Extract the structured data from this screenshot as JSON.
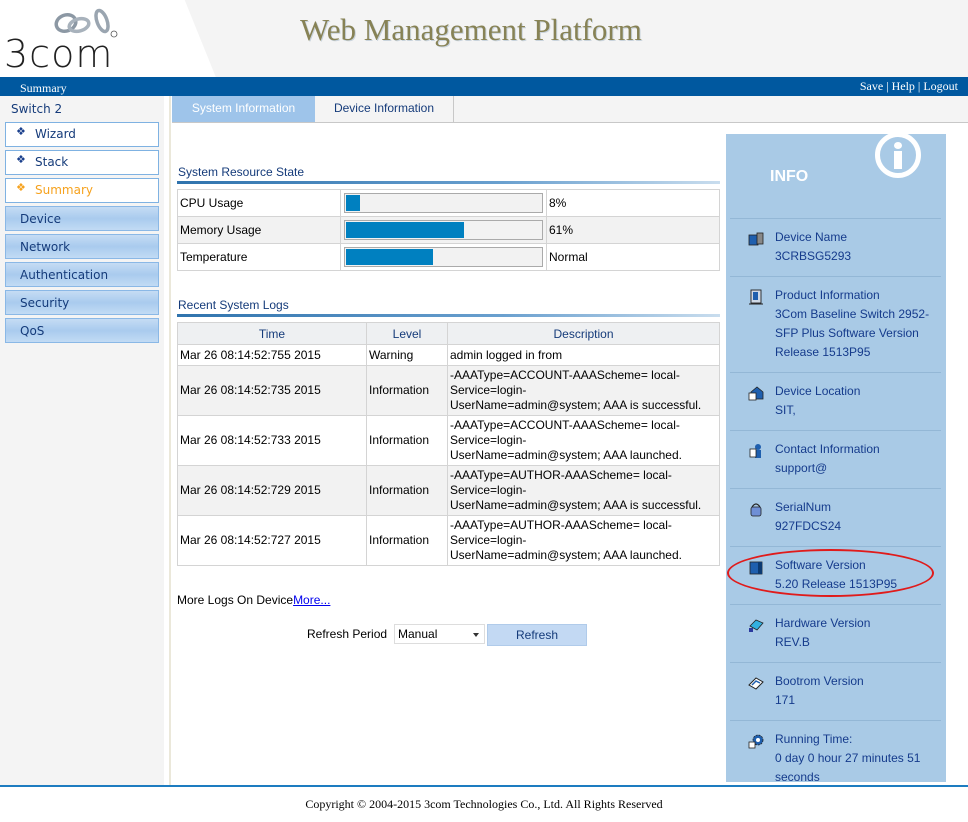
{
  "header": {
    "logo_text": "3com",
    "title": "Web Management Platform"
  },
  "topbar": {
    "breadcrumb": "Summary",
    "links": [
      "Save",
      "Help",
      "Logout"
    ],
    "separator": " | "
  },
  "sidebar": {
    "device_label": "Switch 2",
    "sub_items": [
      {
        "label": "Wizard",
        "active": false
      },
      {
        "label": "Stack",
        "active": false
      },
      {
        "label": "Summary",
        "active": true
      }
    ],
    "groups": [
      "Device",
      "Network",
      "Authentication",
      "Security",
      "QoS"
    ]
  },
  "tabs": [
    {
      "label": "System Information",
      "active": true
    },
    {
      "label": "Device Information",
      "active": false
    }
  ],
  "resources": {
    "title": "System Resource State",
    "rows": [
      {
        "label": "CPU Usage",
        "fill_percent": 8,
        "value": "8%"
      },
      {
        "label": "Memory Usage",
        "fill_percent": 61,
        "value": "61%"
      },
      {
        "label": "Temperature",
        "fill_percent": 45,
        "value": "Normal"
      }
    ]
  },
  "logs": {
    "title": "Recent System Logs",
    "columns": [
      "Time",
      "Level",
      "Description"
    ],
    "rows": [
      {
        "time": "Mar 26 08:14:52:755 2015",
        "level": "Warning",
        "desc": "admin logged in from"
      },
      {
        "time": "Mar 26 08:14:52:735 2015",
        "level": "Information",
        "desc": "-AAAType=ACCOUNT-AAAScheme= local-\nService=login-\nUserName=admin@system; AAA is successful."
      },
      {
        "time": "Mar 26 08:14:52:733 2015",
        "level": "Information",
        "desc": "-AAAType=ACCOUNT-AAAScheme= local-\nService=login-\nUserName=admin@system; AAA launched."
      },
      {
        "time": "Mar 26 08:14:52:729 2015",
        "level": "Information",
        "desc": "-AAAType=AUTHOR-AAAScheme= local-\nService=login-\nUserName=admin@system; AAA is successful."
      },
      {
        "time": "Mar 26 08:14:52:727 2015",
        "level": "Information",
        "desc": "-AAAType=AUTHOR-AAAScheme= local-\nService=login-\nUserName=admin@system; AAA launched."
      }
    ],
    "more_text": "More Logs On Device",
    "more_link": "More..."
  },
  "refresh": {
    "label": "Refresh Period",
    "selected": "Manual",
    "button": "Refresh"
  },
  "info": {
    "title": "INFO",
    "items": [
      {
        "label": "Device Name",
        "value": "3CRBSG5293",
        "icon": "device-icon"
      },
      {
        "label": "Product Information",
        "value": "3Com Baseline Switch 2952-SFP Plus Software Version Release 1513P95",
        "icon": "product-icon"
      },
      {
        "label": "Device Location",
        "value": "SIT,",
        "icon": "location-icon"
      },
      {
        "label": "Contact Information",
        "value": "support@",
        "icon": "contact-icon"
      },
      {
        "label": "SerialNum",
        "value": "927FDCS24",
        "icon": "serial-icon"
      },
      {
        "label": "Software Version",
        "value": "5.20 Release 1513P95",
        "icon": "software-icon",
        "highlighted": true
      },
      {
        "label": "Hardware Version",
        "value": "REV.B",
        "icon": "hardware-icon"
      },
      {
        "label": "Bootrom Version",
        "value": "171",
        "icon": "bootrom-icon"
      },
      {
        "label": "Running Time:",
        "value": "0 day 0 hour 27 minutes 51 seconds",
        "icon": "gear-icon"
      }
    ]
  },
  "colors": {
    "brand_blue": "#00589f",
    "bar_fill": "#0080c0",
    "active_nav": "#f6a21e",
    "highlight_oval": "#e01b1b"
  },
  "footer": {
    "copyright": "Copyright © 2004-2015 3com Technologies Co., Ltd. All Rights Reserved"
  }
}
